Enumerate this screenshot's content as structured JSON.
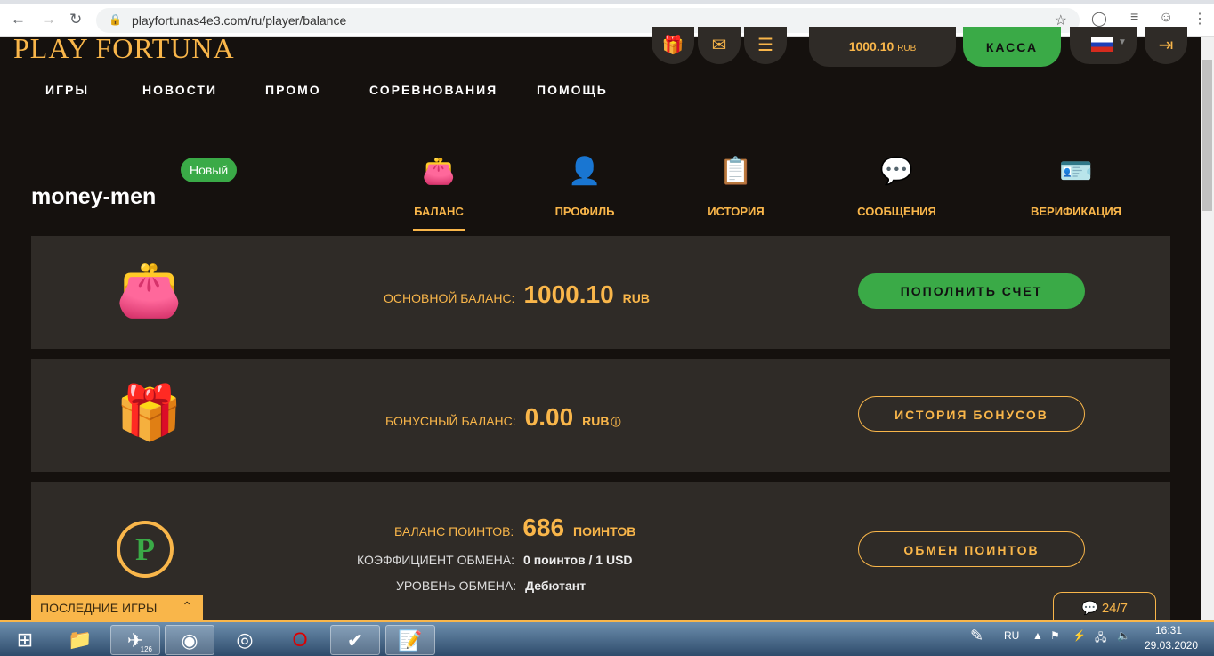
{
  "browser": {
    "url": "playfortunas4e3.com/ru/player/balance"
  },
  "header": {
    "logo": "PLAY FORTUNA",
    "balance": "1000.10",
    "currency": "RUB",
    "kassa": "КАССА"
  },
  "nav": [
    "ИГРЫ",
    "НОВОСТИ",
    "ПРОМО",
    "СОРЕВНОВАНИЯ",
    "ПОМОЩЬ"
  ],
  "profile": {
    "username": "money-men",
    "badge": "Новый"
  },
  "tabs": [
    "БАЛАНС",
    "ПРОФИЛЬ",
    "ИСТОРИЯ",
    "СООБЩЕНИЯ",
    "ВЕРИФИКАЦИЯ"
  ],
  "main_balance": {
    "label": "ОСНОВНОЙ БАЛАНС:",
    "value": "1000.10",
    "unit": "RUB",
    "button": "ПОПОЛНИТЬ СЧЕТ"
  },
  "bonus_balance": {
    "label": "БОНУСНЫЙ БАЛАНС:",
    "value": "0.00",
    "unit": "RUB",
    "button": "ИСТОРИЯ БОНУСОВ"
  },
  "points": {
    "label": "БАЛАНС ПОИНТОВ:",
    "value": "686",
    "unit": "ПОИНТОВ",
    "rate_label": "КОЭФФИЦИЕНТ ОБМЕНА:",
    "rate_value": "0 поинтов / 1 USD",
    "level_label": "УРОВЕНЬ ОБМЕНА:",
    "level_value": "Дебютант",
    "button": "ОБМЕН ПОИНТОВ",
    "icon_letter": "P"
  },
  "recent_games": "ПОСЛЕДНИЕ ИГРЫ",
  "chat": "24/7",
  "taskbar": {
    "lang": "RU",
    "time": "16:31",
    "date": "29.03.2020",
    "telegram_badge": "126"
  }
}
